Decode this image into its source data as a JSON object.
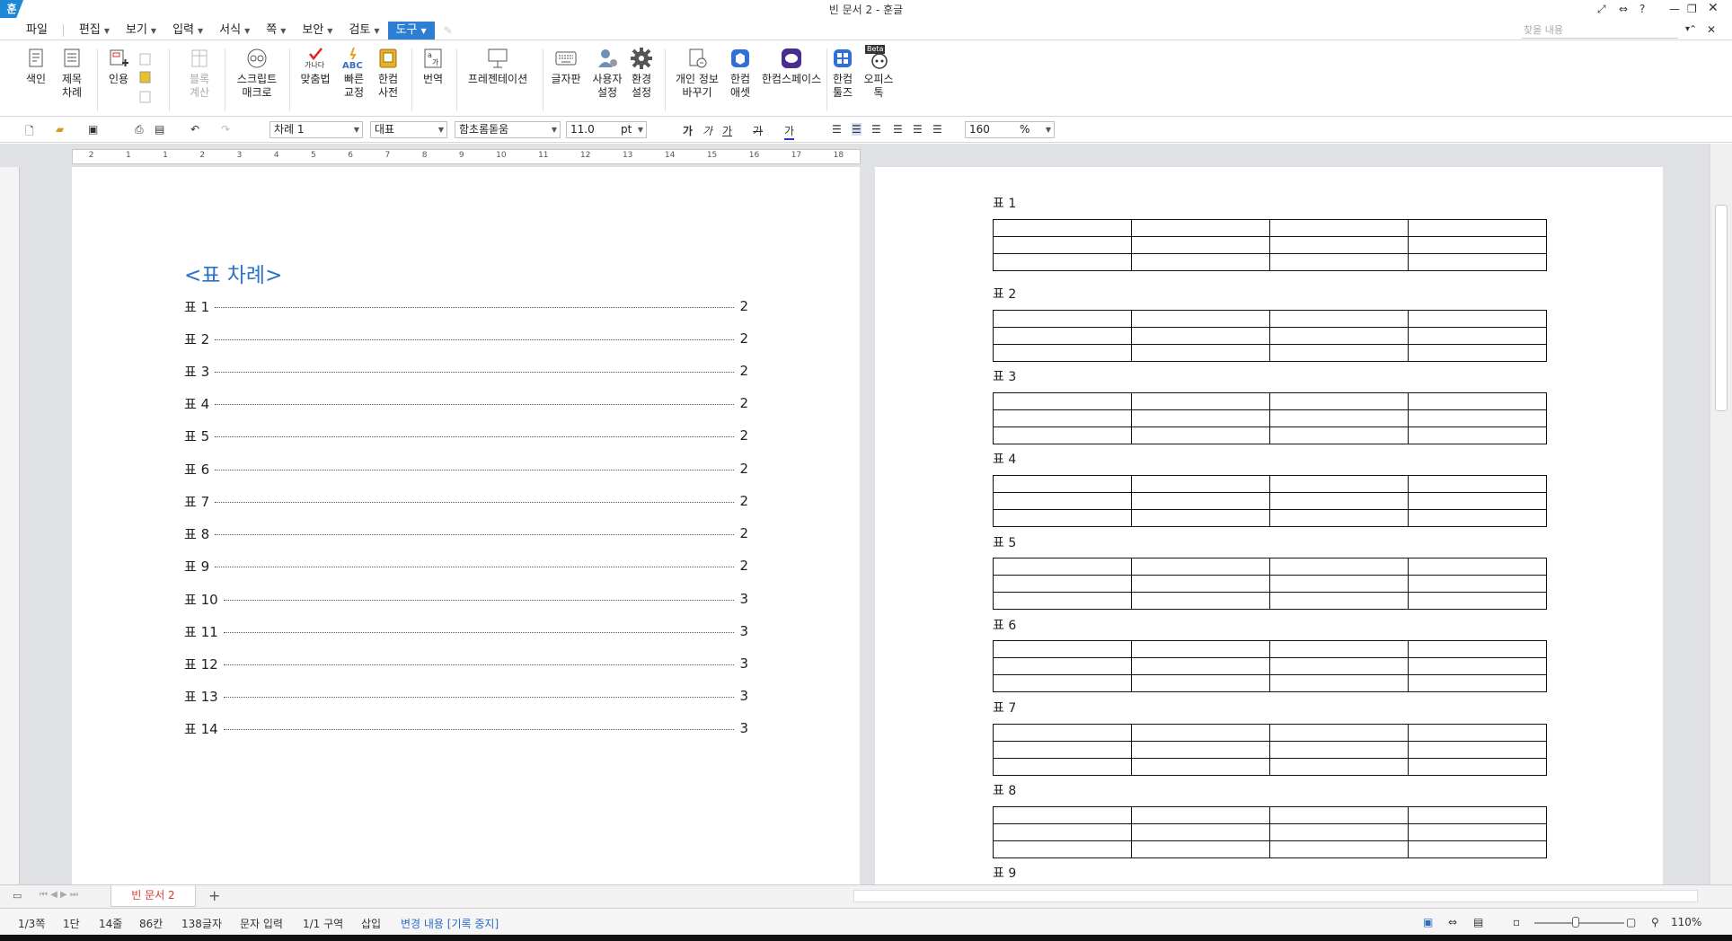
{
  "window": {
    "title": "빈 문서 2 - 훈글",
    "logo": "훈"
  },
  "menu": {
    "items": [
      {
        "label": "파일",
        "dropdown": false
      },
      {
        "label": "편집",
        "dropdown": true
      },
      {
        "label": "보기",
        "dropdown": true
      },
      {
        "label": "입력",
        "dropdown": true
      },
      {
        "label": "서식",
        "dropdown": true
      },
      {
        "label": "쪽",
        "dropdown": true
      },
      {
        "label": "보안",
        "dropdown": true
      },
      {
        "label": "검토",
        "dropdown": true
      },
      {
        "label": "도구",
        "dropdown": true,
        "active": true
      }
    ],
    "search_placeholder": "찾을 내용"
  },
  "ribbon": {
    "buttons": [
      {
        "l1": "색인",
        "l2": "",
        "icon": "index-icon"
      },
      {
        "l1": "제목",
        "l2": "차례",
        "icon": "toc-icon"
      },
      {
        "l1": "인용",
        "l2": "",
        "icon": "citation-icon"
      },
      {
        "l1": "블록",
        "l2": "계산",
        "icon": "block-calc-icon",
        "disabled": true
      },
      {
        "l1": "스크립트",
        "l2": "매크로",
        "icon": "macro-icon"
      },
      {
        "l1": "맞춤법",
        "l2": "",
        "icon": "spellcheck-icon"
      },
      {
        "l1": "빠른",
        "l2": "교정",
        "icon": "quick-correct-icon"
      },
      {
        "l1": "한컴",
        "l2": "사전",
        "icon": "dictionary-icon"
      },
      {
        "l1": "번역",
        "l2": "",
        "icon": "translate-icon"
      },
      {
        "l1": "프레젠테이션",
        "l2": "",
        "icon": "presentation-icon"
      },
      {
        "l1": "글자판",
        "l2": "",
        "icon": "keyboard-icon"
      },
      {
        "l1": "사용자",
        "l2": "설정",
        "icon": "user-settings-icon"
      },
      {
        "l1": "환경",
        "l2": "설정",
        "icon": "gear-icon"
      },
      {
        "l1": "개인 정보",
        "l2": "바꾸기",
        "icon": "privacy-icon"
      },
      {
        "l1": "한컴",
        "l2": "애셋",
        "icon": "asset-icon"
      },
      {
        "l1": "한컴스페이스",
        "l2": "",
        "icon": "space-icon"
      },
      {
        "l1": "한컴",
        "l2": "툴즈",
        "icon": "tools-icon"
      },
      {
        "l1": "오피스",
        "l2": "톡",
        "icon": "office-talk-icon",
        "badge": "Beta"
      }
    ]
  },
  "format": {
    "style": "차례 1",
    "lang": "대표",
    "font": "함초롬돋움",
    "size": "11.0",
    "unit": "pt",
    "bold": "가",
    "italic": "가",
    "underline": "가",
    "strike": "가",
    "color": "가",
    "zoom": "160",
    "zoom_unit": "%"
  },
  "ruler": {
    "ticks": [
      "2",
      "1",
      "1",
      "2",
      "3",
      "4",
      "5",
      "6",
      "7",
      "8",
      "9",
      "10",
      "11",
      "12",
      "13",
      "14",
      "15",
      "16",
      "17",
      "18"
    ]
  },
  "toc": {
    "title": "<표 차례>",
    "entries": [
      {
        "label": "표 1",
        "page": "2"
      },
      {
        "label": "표 2",
        "page": "2"
      },
      {
        "label": "표 3",
        "page": "2"
      },
      {
        "label": "표 4",
        "page": "2"
      },
      {
        "label": "표 5",
        "page": "2"
      },
      {
        "label": "표 6",
        "page": "2"
      },
      {
        "label": "표 7",
        "page": "2"
      },
      {
        "label": "표 8",
        "page": "2"
      },
      {
        "label": "표 9",
        "page": "2"
      },
      {
        "label": "표 10",
        "page": "3"
      },
      {
        "label": "표 11",
        "page": "3"
      },
      {
        "label": "표 12",
        "page": "3"
      },
      {
        "label": "표 13",
        "page": "3"
      },
      {
        "label": "표 14",
        "page": "3"
      }
    ]
  },
  "page2": {
    "captions": [
      "표 1",
      "표 2",
      "표 3",
      "표 4",
      "표 5",
      "표 6",
      "표 7",
      "표 8",
      "표 9"
    ]
  },
  "tabs": {
    "doc": "빈 문서 2",
    "add": "+"
  },
  "status": {
    "page": "1/3쪽",
    "col": "1단",
    "line": "14줄",
    "pos": "86칸",
    "chars": "138글자",
    "mode": "문자 입력",
    "section": "1/1 구역",
    "insert": "삽입",
    "track": "변경 내용 [기록 중지]",
    "zoom": "110%"
  },
  "colors": {
    "accent": "#2d7fd2",
    "toc_title": "#2b73c8",
    "tab_text": "#d03b2e"
  }
}
